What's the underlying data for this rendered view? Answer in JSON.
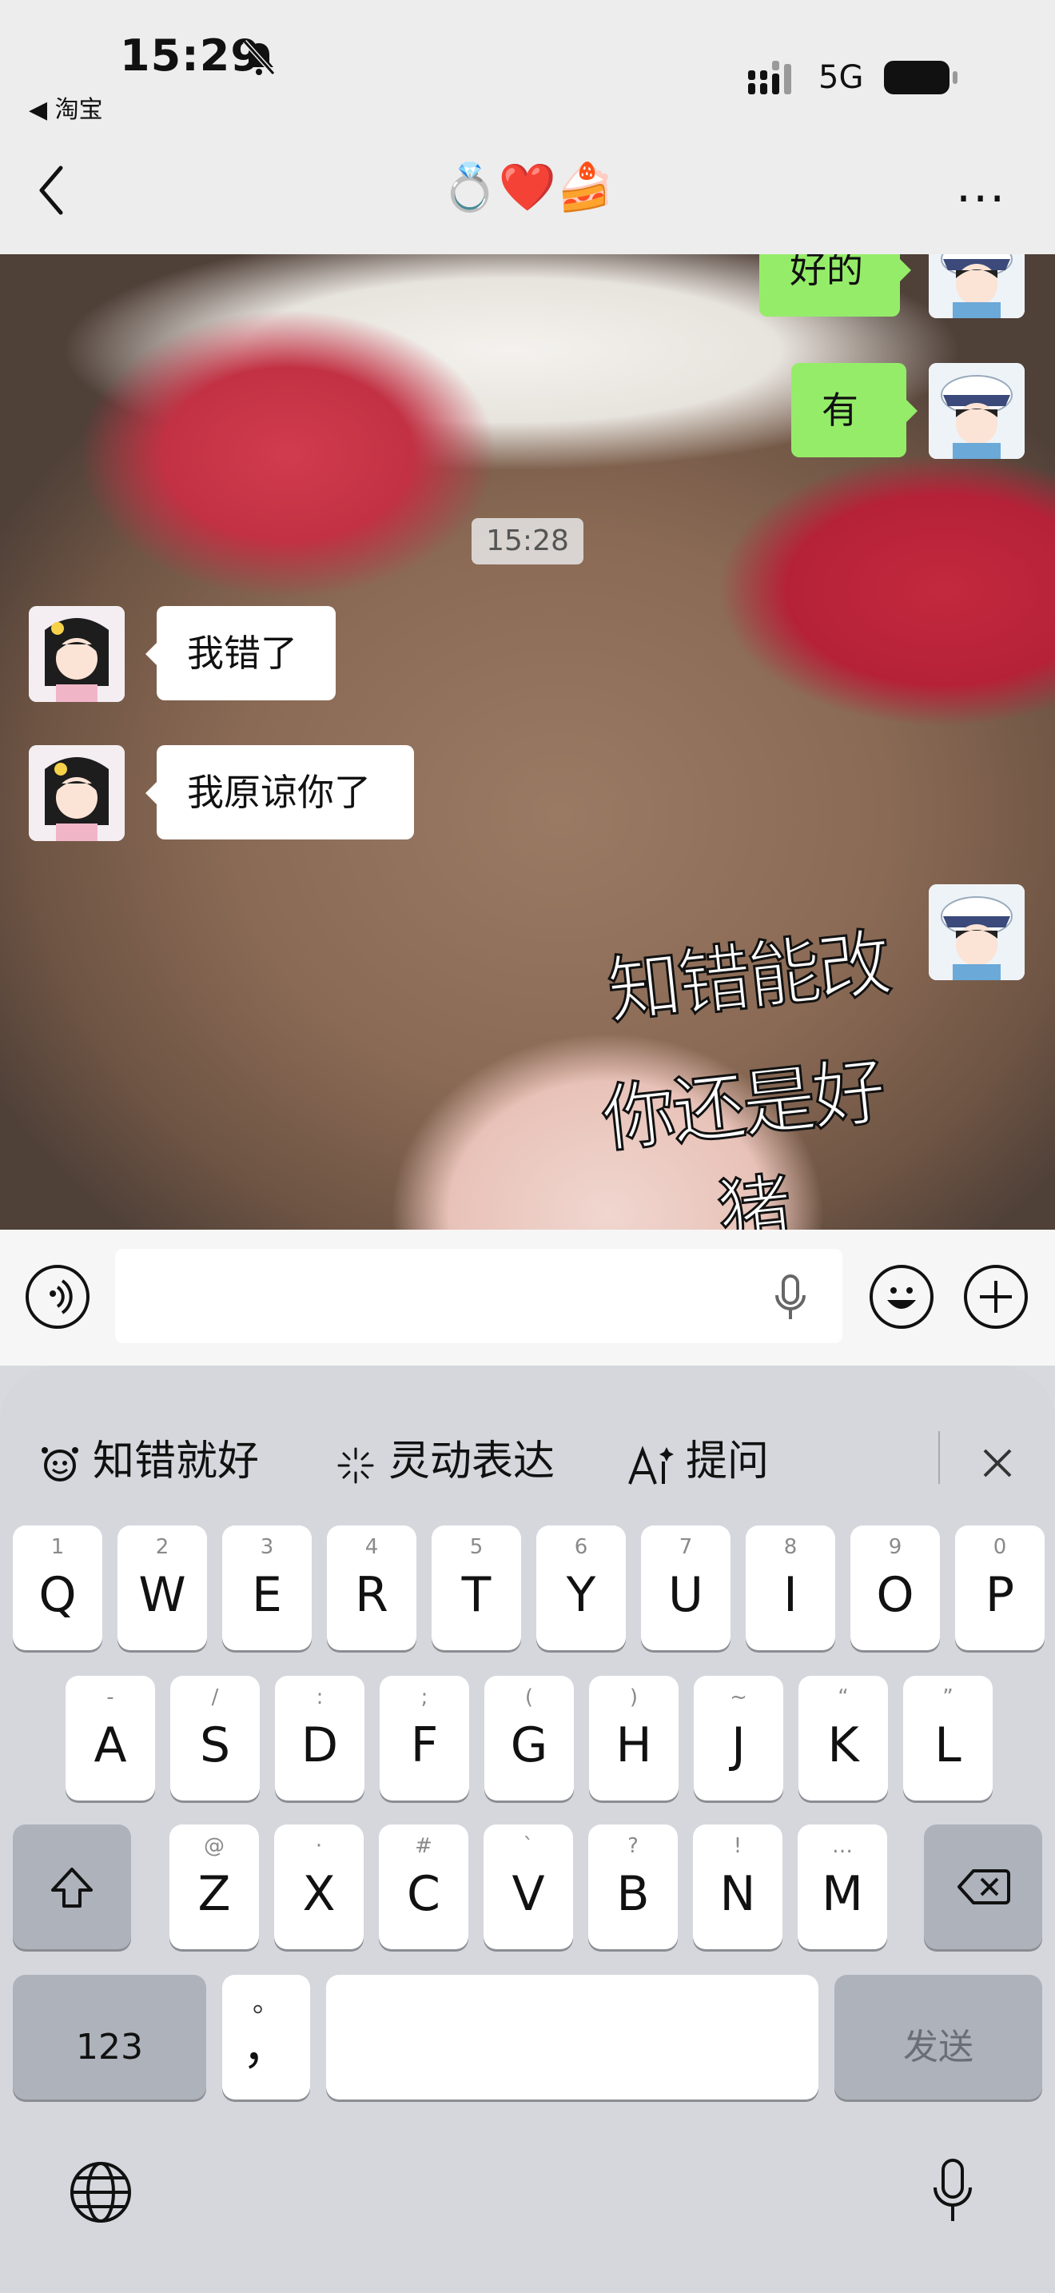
{
  "status_bar": {
    "time": "15:29",
    "back_app": "◀ 淘宝",
    "network": "5G"
  },
  "nav": {
    "title": "💍❤️🍰",
    "more": "···"
  },
  "chat": {
    "timestamp": "15:28",
    "outgoing": [
      {
        "text": "好的"
      },
      {
        "text": "有"
      }
    ],
    "incoming": [
      {
        "text": "我错了"
      },
      {
        "text": "我原谅你了"
      }
    ],
    "sticker_lines": [
      "知错能改",
      "你还是好猪"
    ]
  },
  "input": {
    "placeholder": ""
  },
  "suggestions": [
    {
      "label": "知错就好",
      "icon": "emoji-face-icon"
    },
    {
      "label": "灵动表达",
      "icon": "sparkle-icon"
    },
    {
      "label": "提问",
      "icon": "ai-icon"
    }
  ],
  "keyboard": {
    "row1": [
      {
        "k": "Q",
        "h": "1"
      },
      {
        "k": "W",
        "h": "2"
      },
      {
        "k": "E",
        "h": "3"
      },
      {
        "k": "R",
        "h": "4"
      },
      {
        "k": "T",
        "h": "5"
      },
      {
        "k": "Y",
        "h": "6"
      },
      {
        "k": "U",
        "h": "7"
      },
      {
        "k": "I",
        "h": "8"
      },
      {
        "k": "O",
        "h": "9"
      },
      {
        "k": "P",
        "h": "0"
      }
    ],
    "row2": [
      {
        "k": "A",
        "h": "-"
      },
      {
        "k": "S",
        "h": "/"
      },
      {
        "k": "D",
        "h": ":"
      },
      {
        "k": "F",
        "h": ";"
      },
      {
        "k": "G",
        "h": "("
      },
      {
        "k": "H",
        "h": ")"
      },
      {
        "k": "J",
        "h": "~"
      },
      {
        "k": "K",
        "h": "“"
      },
      {
        "k": "L",
        "h": "”"
      }
    ],
    "row3": [
      {
        "k": "Z",
        "h": "@"
      },
      {
        "k": "X",
        "h": "·"
      },
      {
        "k": "C",
        "h": "#"
      },
      {
        "k": "V",
        "h": "`"
      },
      {
        "k": "B",
        "h": "?"
      },
      {
        "k": "N",
        "h": "!"
      },
      {
        "k": "M",
        "h": "…"
      }
    ],
    "numbers_label": "123",
    "punct_main": "，",
    "punct_hint": "。",
    "send_label": "发送"
  }
}
